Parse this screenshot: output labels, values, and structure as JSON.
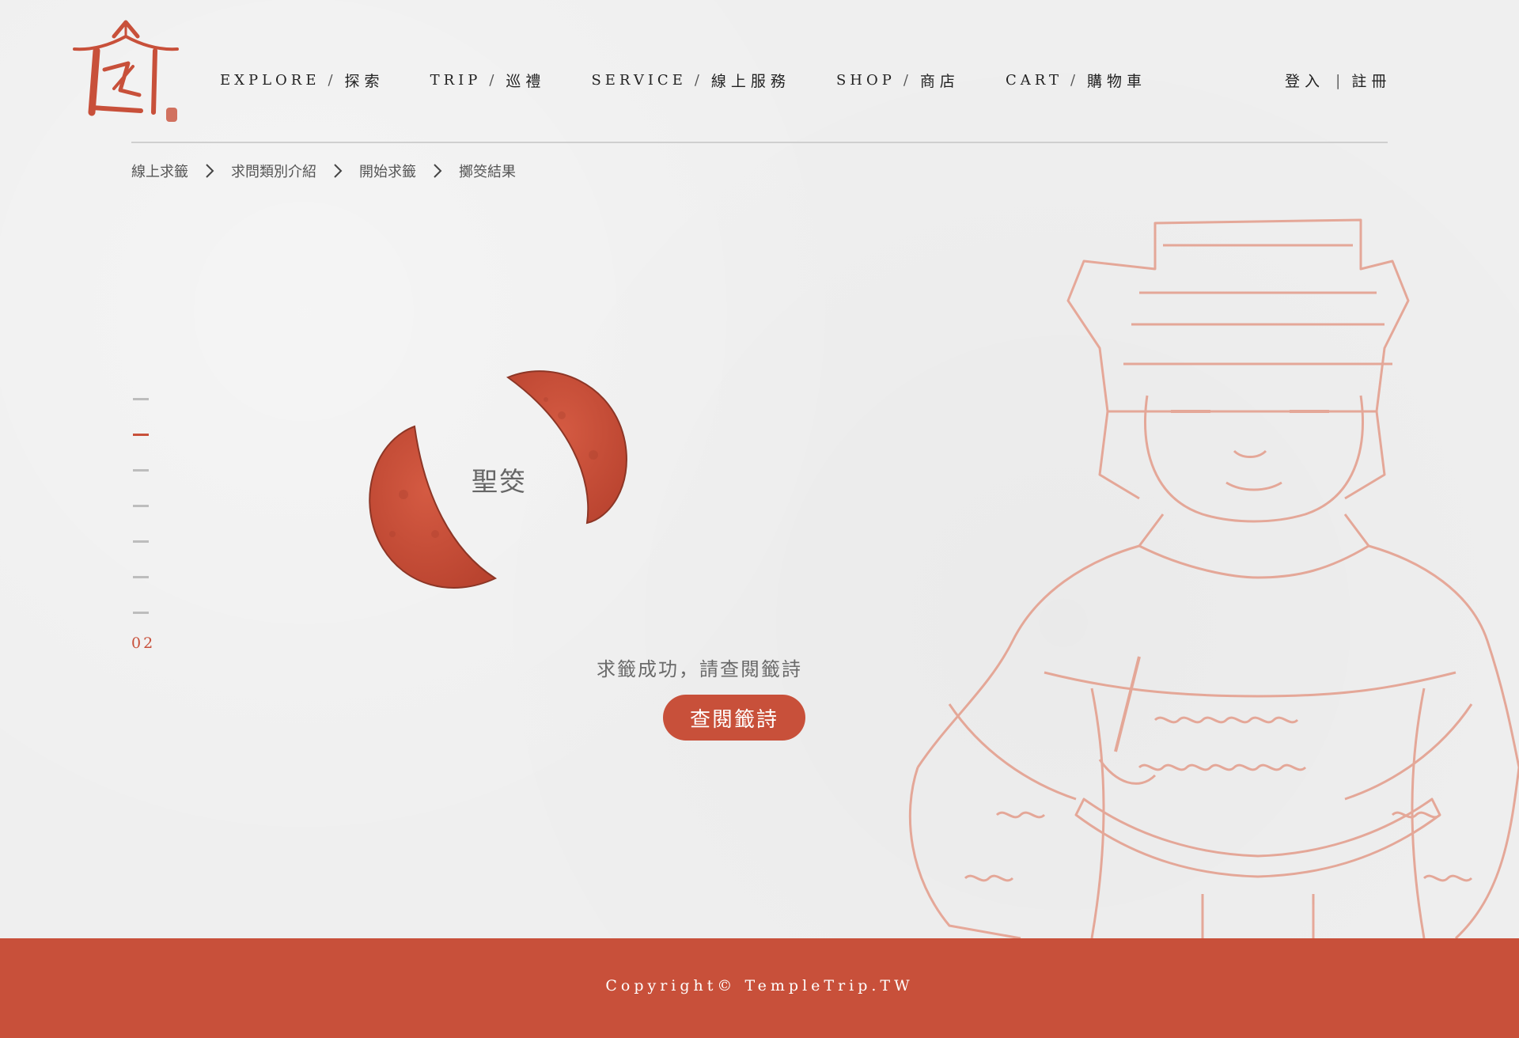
{
  "header": {
    "logo_name": "temple-trip-logo",
    "nav": [
      {
        "en": "EXPLORE",
        "sep": "/",
        "zh": "探索"
      },
      {
        "en": "TRIP",
        "sep": "/",
        "zh": "巡禮"
      },
      {
        "en": "SERVICE",
        "sep": "/",
        "zh": "線上服務"
      },
      {
        "en": "SHOP",
        "sep": "/",
        "zh": "商店"
      },
      {
        "en": "CART",
        "sep": "/",
        "zh": "購物車"
      }
    ],
    "auth": {
      "login": "登入",
      "divider": "|",
      "register": "註冊"
    }
  },
  "breadcrumb": [
    "線上求籤",
    "求問類別介紹",
    "開始求籤",
    "擲筊結果"
  ],
  "steps": {
    "total": 7,
    "current": 2,
    "label": "02"
  },
  "result": {
    "label": "聖筊",
    "message": "求籤成功，請查閱籤詩",
    "button": "查閱籤詩"
  },
  "footer": {
    "copyright": "Copyright© TempleTrip.TW"
  },
  "colors": {
    "accent": "#c8503a",
    "background": "#efefef",
    "sketch": "#e4a08f"
  }
}
